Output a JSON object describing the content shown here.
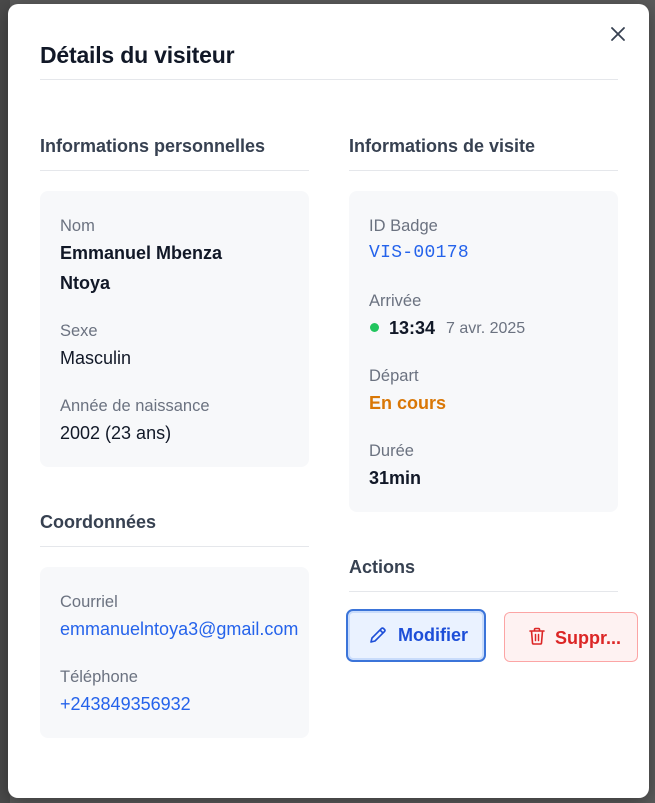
{
  "dialog": {
    "title": "Détails du visiteur",
    "close_icon": "close-icon"
  },
  "personal": {
    "section_title": "Informations personnelles",
    "name_label": "Nom",
    "name_line1": "Emmanuel Mbenza",
    "name_line2": "Ntoya",
    "sex_label": "Sexe",
    "sex_value": "Masculin",
    "birth_label": "Année de naissance",
    "birth_value": "2002 (23 ans)"
  },
  "contact": {
    "section_title": "Coordonnées",
    "email_label": "Courriel",
    "email_value": "emmanuelntoya3@gmail.com",
    "phone_label": "Téléphone",
    "phone_value": "+243849356932"
  },
  "visit": {
    "section_title": "Informations de visite",
    "badge_label": "ID Badge",
    "badge_value": "VIS-00178",
    "arrival_label": "Arrivée",
    "arrival_time": "13:34",
    "arrival_date": "7 avr. 2025",
    "departure_label": "Départ",
    "departure_value": "En cours",
    "duration_label": "Durée",
    "duration_value": "31min"
  },
  "actions": {
    "section_title": "Actions",
    "edit_label": "Modifier",
    "delete_label": "Suppr..."
  },
  "colors": {
    "accent": "#2563eb",
    "status_in_progress": "#d97706",
    "status_dot": "#22c55e",
    "danger": "#dc2626"
  }
}
